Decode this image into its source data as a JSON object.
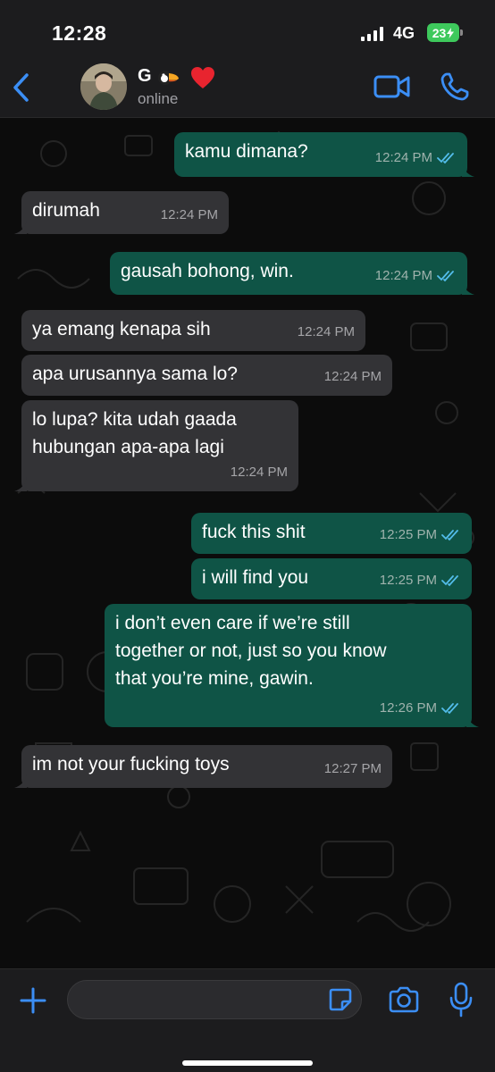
{
  "status_bar": {
    "time": "12:28",
    "network": "4G",
    "battery": "23"
  },
  "header": {
    "contact_name": "G",
    "contact_emojis": [
      "toucan",
      "red-heart"
    ],
    "status": "online"
  },
  "messages": [
    {
      "direction": "outgoing",
      "lines": [
        "kamu dimana?"
      ],
      "time": "12:24 PM",
      "read": true
    },
    {
      "direction": "incoming",
      "lines": [
        "dirumah"
      ],
      "time": "12:24 PM"
    },
    {
      "direction": "outgoing",
      "lines": [
        "gausah bohong, win."
      ],
      "time": "12:24 PM",
      "read": true
    },
    {
      "direction": "incoming",
      "lines": [
        "ya emang kenapa sih"
      ],
      "time": "12:24 PM"
    },
    {
      "direction": "incoming",
      "lines": [
        "apa urusannya sama lo?"
      ],
      "time": "12:24 PM"
    },
    {
      "direction": "incoming",
      "lines": [
        "lo lupa? kita udah gaada",
        "hubungan apa-apa lagi"
      ],
      "time": "12:24 PM"
    },
    {
      "direction": "outgoing",
      "lines": [
        "fuck this shit"
      ],
      "time": "12:25 PM",
      "read": true
    },
    {
      "direction": "outgoing",
      "lines": [
        "i will find you"
      ],
      "time": "12:25 PM",
      "read": true
    },
    {
      "direction": "outgoing",
      "lines": [
        "i don’t even care if we’re still",
        "together or not, just so you know",
        "that you’re mine, gawin."
      ],
      "time": "12:26 PM",
      "read": true
    },
    {
      "direction": "incoming",
      "lines": [
        "im not your fucking toys"
      ],
      "time": "12:27 PM"
    }
  ],
  "input": {
    "placeholder": ""
  },
  "colors": {
    "accent": "#3b8ef5",
    "outgoing_bubble": "#0f5446",
    "incoming_bubble": "#333336",
    "read_ticks": "#53bdeb"
  }
}
